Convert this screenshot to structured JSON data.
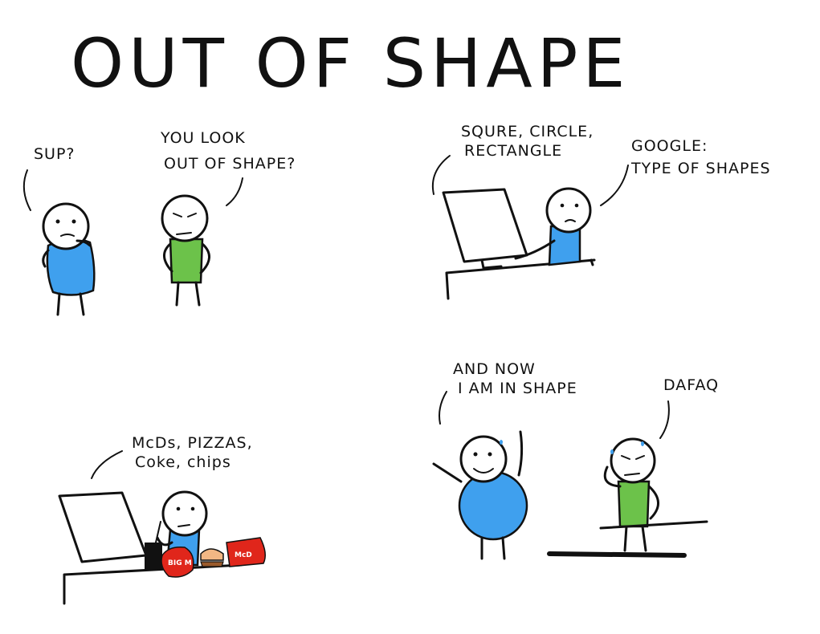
{
  "title": "OUT OF SHAPE",
  "panels": [
    {
      "id": 1,
      "speech": [
        {
          "lines": [
            "SUP?"
          ]
        },
        {
          "lines": [
            "YOU LOOK",
            "OUT OF SHAPE?"
          ]
        }
      ]
    },
    {
      "id": 2,
      "speech": [
        {
          "lines": [
            "SQURE, CIRCLE,",
            "RECTANGLE"
          ]
        },
        {
          "lines": [
            "GOOGLE:",
            "TYPE OF SHAPES"
          ]
        }
      ]
    },
    {
      "id": 3,
      "speech": [
        {
          "lines": [
            "McDs, PIZZAS,",
            "Coke, chips"
          ]
        }
      ]
    },
    {
      "id": 4,
      "speech": [
        {
          "lines": [
            "AND NOW",
            "I AM IN SHAPE"
          ]
        },
        {
          "lines": [
            "DAFAQ"
          ]
        }
      ]
    }
  ],
  "food_labels": {
    "bigmac": "BIG M",
    "box": "McD"
  },
  "colors": {
    "ink": "#111111",
    "shirt_blue": "#3fa0ee",
    "shirt_green": "#6cc24a",
    "food_red": "#e0261b",
    "food_yellow": "#f7c31b"
  }
}
